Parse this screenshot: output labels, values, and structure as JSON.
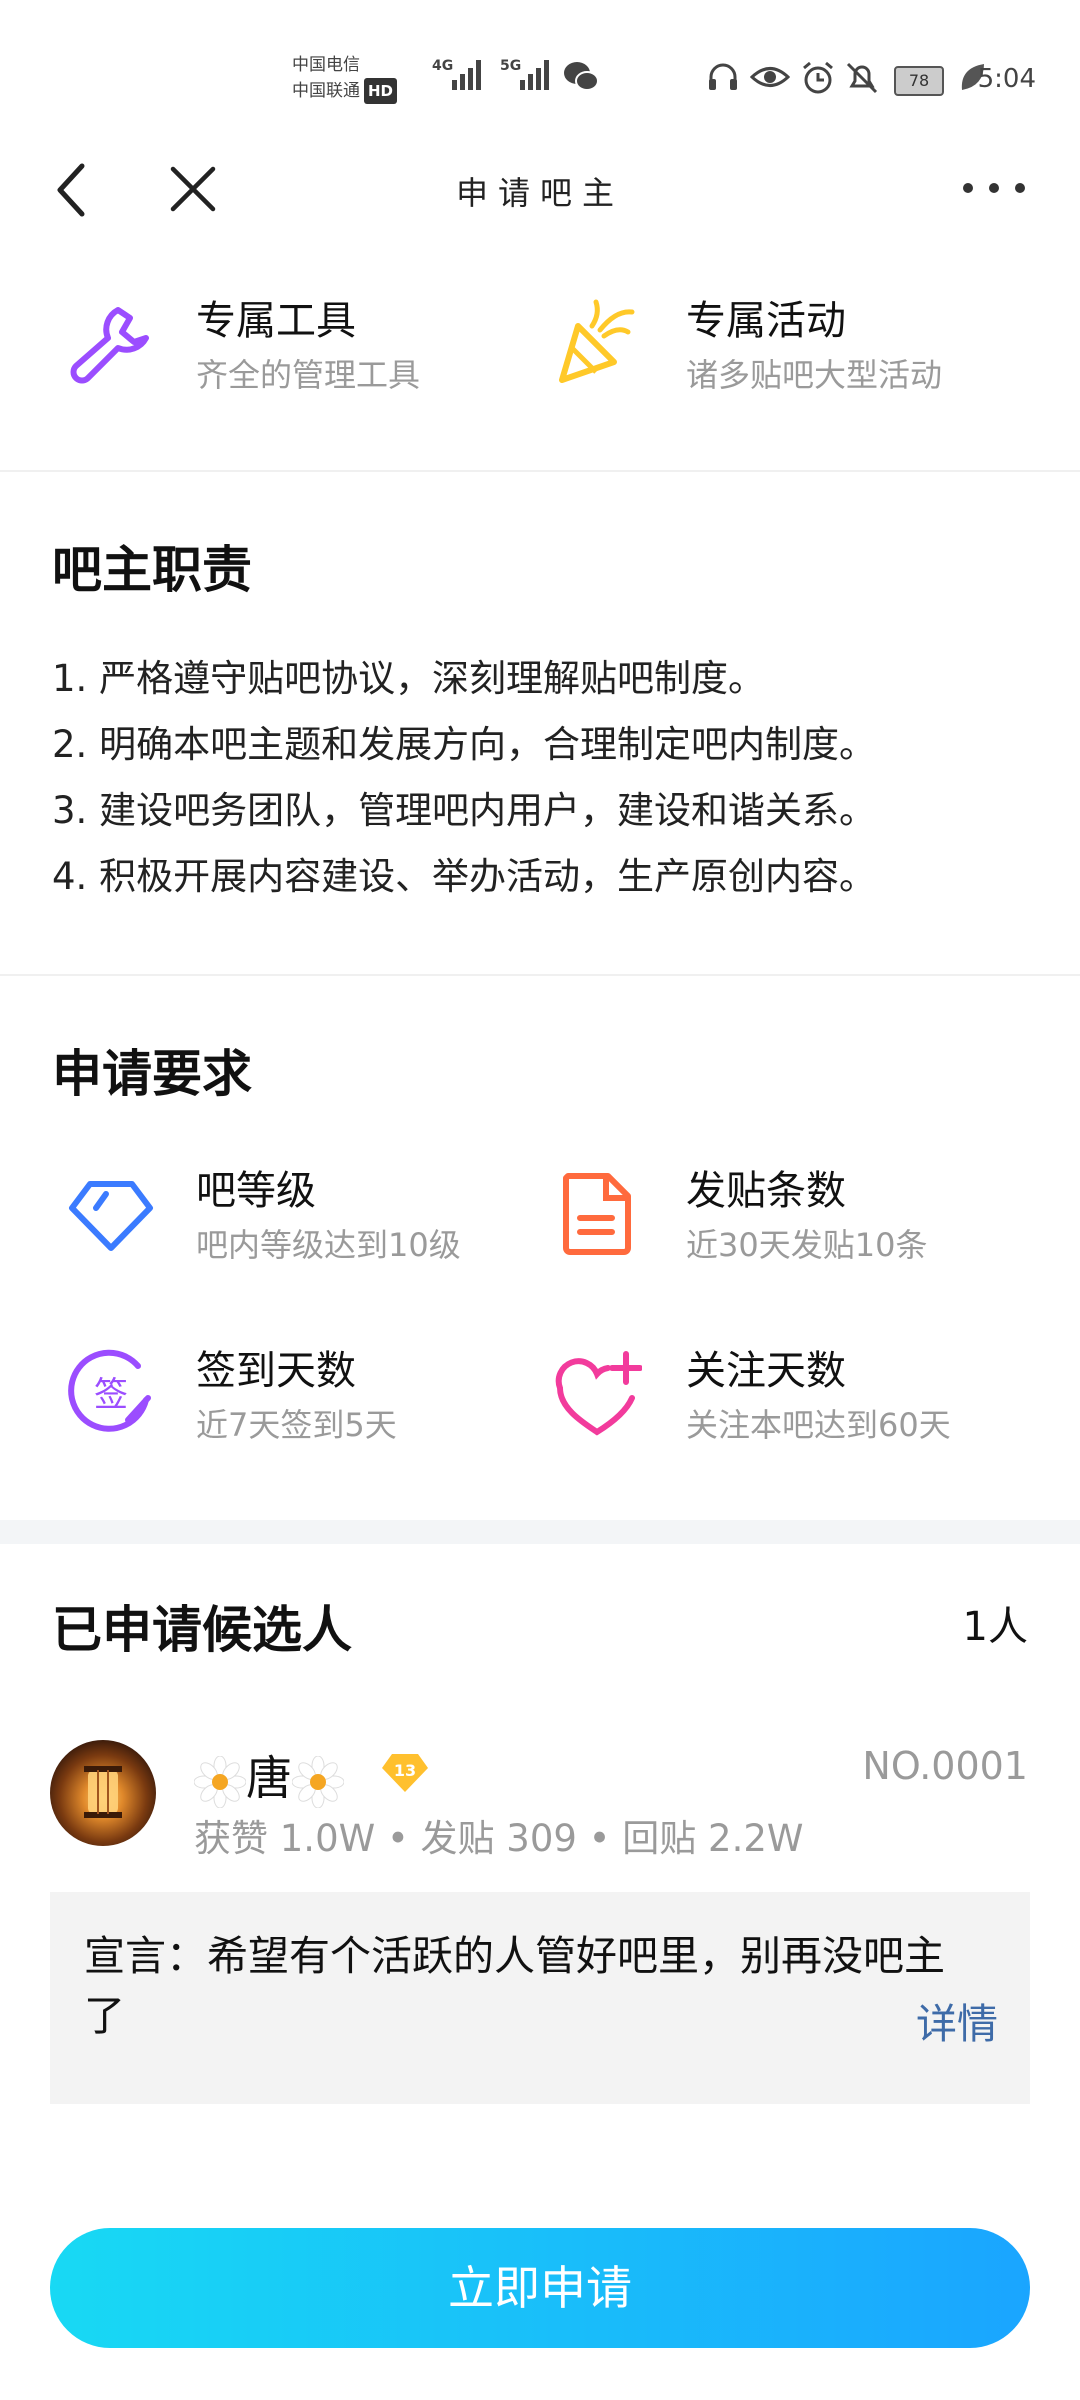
{
  "status_bar": {
    "carrier_1": "中国电信",
    "carrier_2": "中国联通",
    "hd": "HD",
    "net1": "4G",
    "net2": "5G",
    "battery": "78",
    "time": "5:04"
  },
  "nav": {
    "title": "申请吧主"
  },
  "features": [
    {
      "title": "专属工具",
      "subtitle": "齐全的管理工具",
      "icon": "wrench-icon"
    },
    {
      "title": "专属活动",
      "subtitle": "诸多贴吧大型活动",
      "icon": "party-popper-icon"
    }
  ],
  "duties": {
    "title": "吧主职责",
    "items": [
      "1. 严格遵守贴吧协议，深刻理解贴吧制度。",
      "2. 明确本吧主题和发展方向，合理制定吧内制度。",
      "3. 建设吧务团队，管理吧内用户，建设和谐关系。",
      "4. 积极开展内容建设、举办活动，生产原创内容。"
    ]
  },
  "requirements": {
    "title": "申请要求",
    "items": [
      {
        "title": "吧等级",
        "subtitle": "吧内等级达到10级",
        "icon": "diamond-icon"
      },
      {
        "title": "发贴条数",
        "subtitle": "近30天发贴10条",
        "icon": "document-icon"
      },
      {
        "title": "签到天数",
        "subtitle": "近7天签到5天",
        "icon": "sign-in-icon",
        "glyph": "签"
      },
      {
        "title": "关注天数",
        "subtitle": "关注本吧达到60天",
        "icon": "heart-plus-icon"
      }
    ]
  },
  "candidates": {
    "title": "已申请候选人",
    "count": "1人",
    "list": [
      {
        "name": "唐",
        "level": "13",
        "number": "NO.0001",
        "stats": "获赞 1.0W • 发贴 309 • 回贴 2.2W",
        "declaration": "宣言：希望有个活跃的人管好吧里，别再没吧主了",
        "detail_label": "详情"
      }
    ]
  },
  "apply_button": "立即申请",
  "colors": {
    "accent_blue": "#1aa5ff",
    "purple": "#9b4dff",
    "orange": "#ff6a3d",
    "pink": "#f23b9c",
    "gold": "#ffc929",
    "link": "#3e6ba8"
  }
}
